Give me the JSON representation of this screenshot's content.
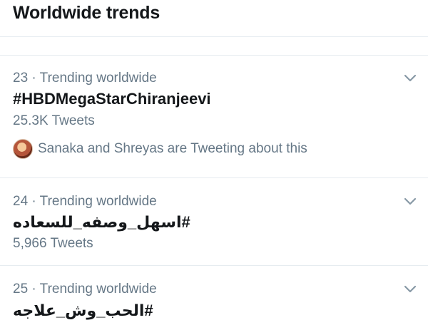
{
  "header": {
    "title": "Worldwide trends"
  },
  "trends": [
    {
      "rank_context": "23 · Trending worldwide",
      "hashtag": "#HBDMegaStarChiranjeevi",
      "count": "25.3K Tweets",
      "social_context": "Sanaka and Shreyas are Tweeting about this"
    },
    {
      "rank_context": "24 · Trending worldwide",
      "hashtag": "#اسهل_وصفه_للسعاده",
      "count": "5,966 Tweets"
    },
    {
      "rank_context": "25 · Trending worldwide",
      "hashtag": "#الحب_وش_علاجه"
    }
  ],
  "icons": {
    "more": "chevron-down-icon",
    "avatar": "avatar"
  },
  "colors": {
    "primary_text": "#14171a",
    "secondary_text": "#657786",
    "divider": "#e6ecf0"
  }
}
